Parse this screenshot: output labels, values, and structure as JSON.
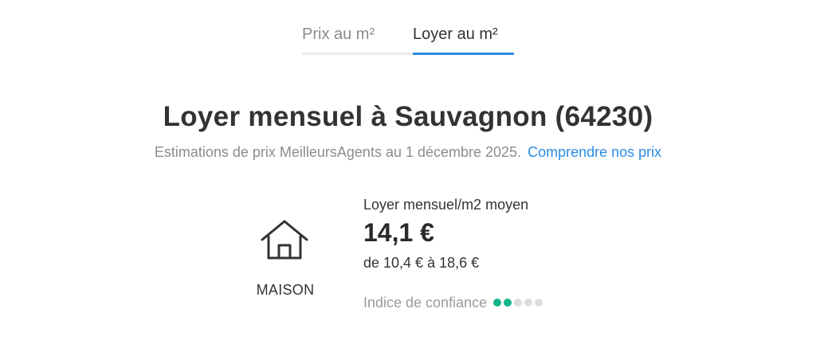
{
  "tabs": [
    {
      "label": "Prix au m²",
      "active": false
    },
    {
      "label": "Loyer au m²",
      "active": true
    }
  ],
  "heading": {
    "title": "Loyer mensuel à Sauvagnon (64230)",
    "subtitle": "Estimations de prix MeilleursAgents au 1 décembre 2025.",
    "link": "Comprendre nos prix"
  },
  "property": {
    "icon": "house-icon",
    "type_label": "MAISON",
    "metric_label": "Loyer mensuel/m2 moyen",
    "value": "14,1 €",
    "range": "de 10,4 € à 18,6 €",
    "confidence_label": "Indice de confiance",
    "confidence_level": 2,
    "confidence_max": 5
  },
  "colors": {
    "accent": "#2b8ce6",
    "confidence_on": "#13b48a",
    "confidence_off": "#dddddd"
  }
}
